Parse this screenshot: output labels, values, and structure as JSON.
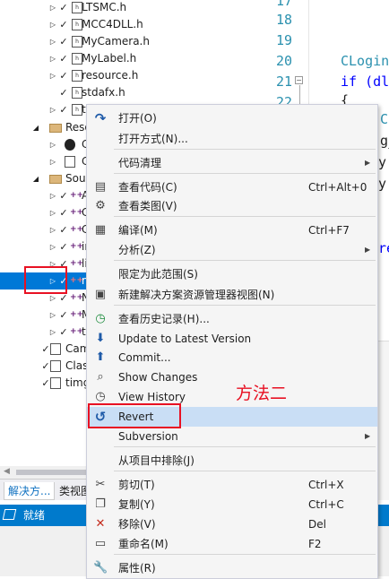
{
  "tree": {
    "rows": [
      {
        "label": "LTSMC.h",
        "icon": "header-file-icon"
      },
      {
        "label": "MCC4DLL.h",
        "icon": "header-file-icon"
      },
      {
        "label": "MyCamera.h",
        "icon": "header-file-icon"
      },
      {
        "label": "MyLabel.h",
        "icon": "header-file-icon"
      },
      {
        "label": "resource.h",
        "icon": "header-file-icon"
      },
      {
        "label": "stdafx.h",
        "icon": "header-file-icon"
      },
      {
        "label": "t",
        "icon": "header-file-icon"
      },
      {
        "label": "Reso",
        "icon": "folder-icon"
      },
      {
        "label": "C",
        "icon": "resource-icon"
      },
      {
        "label": "C",
        "icon": "resource-file-icon"
      },
      {
        "label": "Sour",
        "icon": "folder-icon"
      },
      {
        "label": "A",
        "icon": "cpp-file-icon"
      },
      {
        "label": "C",
        "icon": "cpp-file-icon"
      },
      {
        "label": "C",
        "icon": "cpp-file-icon"
      },
      {
        "label": "in",
        "icon": "cpp-file-icon"
      },
      {
        "label": "li",
        "icon": "cpp-file-icon"
      },
      {
        "label": "m",
        "icon": "cpp-file-icon"
      },
      {
        "label": "N",
        "icon": "cpp-file-icon"
      },
      {
        "label": "M",
        "icon": "cpp-file-icon"
      },
      {
        "label": "tl",
        "icon": "cpp-file-icon"
      },
      {
        "label": "Cam",
        "icon": "text-file-icon"
      },
      {
        "label": "Clas",
        "icon": "text-file-icon"
      },
      {
        "label": "timg",
        "icon": "image-file-icon"
      }
    ]
  },
  "editor": {
    "line_numbers": [
      "17",
      "18",
      "19",
      "20",
      "21",
      "22"
    ],
    "code_lines": [
      {
        "text": "CLogin",
        "kind": "ty"
      },
      {
        "text": "if (dl",
        "kind": "kw"
      },
      {
        "text": "{",
        "kind": "plain"
      }
    ],
    "fragments": [
      "Ca",
      "g_",
      "y.",
      "y.",
      "re"
    ]
  },
  "bottom_tabs": [
    "解决方...",
    "类视图"
  ],
  "status": {
    "text": "就绪"
  },
  "annotation": {
    "text": "方法二"
  },
  "menu": {
    "items": [
      {
        "label": "打开(O)",
        "shortcut": "",
        "submenu": false,
        "icon": "open-arrow-icon"
      },
      {
        "label": "打开方式(N)...",
        "shortcut": "",
        "submenu": false,
        "icon": ""
      },
      {
        "label": "代码清理",
        "shortcut": "",
        "submenu": true,
        "icon": ""
      },
      {
        "label": "查看代码(C)",
        "shortcut": "Ctrl+Alt+0",
        "submenu": false,
        "icon": "view-code-icon"
      },
      {
        "label": "查看类图(V)",
        "shortcut": "",
        "submenu": false,
        "icon": "class-diagram-icon"
      },
      {
        "label": "编译(M)",
        "shortcut": "Ctrl+F7",
        "submenu": false,
        "icon": "compile-icon"
      },
      {
        "label": "分析(Z)",
        "shortcut": "",
        "submenu": true,
        "icon": ""
      },
      {
        "label": "限定为此范围(S)",
        "shortcut": "",
        "submenu": false,
        "icon": ""
      },
      {
        "label": "新建解决方案资源管理器视图(N)",
        "shortcut": "",
        "submenu": false,
        "icon": "new-view-icon"
      },
      {
        "label": "查看历史记录(H)...",
        "shortcut": "",
        "submenu": false,
        "icon": "history-icon"
      },
      {
        "label": "Update to Latest Version",
        "shortcut": "",
        "submenu": false,
        "icon": "update-icon"
      },
      {
        "label": "Commit...",
        "shortcut": "",
        "submenu": false,
        "icon": "commit-icon"
      },
      {
        "label": "Show Changes",
        "shortcut": "",
        "submenu": false,
        "icon": "show-changes-icon"
      },
      {
        "label": "View History",
        "shortcut": "",
        "submenu": false,
        "icon": "view-history-icon"
      },
      {
        "label": "Revert",
        "shortcut": "",
        "submenu": false,
        "icon": "revert-icon"
      },
      {
        "label": "Subversion",
        "shortcut": "",
        "submenu": true,
        "icon": ""
      },
      {
        "label": "从项目中排除(J)",
        "shortcut": "",
        "submenu": false,
        "icon": ""
      },
      {
        "label": "剪切(T)",
        "shortcut": "Ctrl+X",
        "submenu": false,
        "icon": "cut-icon"
      },
      {
        "label": "复制(Y)",
        "shortcut": "Ctrl+C",
        "submenu": false,
        "icon": "copy-icon"
      },
      {
        "label": "移除(V)",
        "shortcut": "Del",
        "submenu": false,
        "icon": "remove-icon"
      },
      {
        "label": "重命名(M)",
        "shortcut": "F2",
        "submenu": false,
        "icon": "rename-icon"
      },
      {
        "label": "属性(R)",
        "shortcut": "",
        "submenu": false,
        "icon": "properties-icon"
      }
    ]
  },
  "colors": {
    "selection": "#0078d7",
    "menu_highlight": "#c9def5",
    "status_bar": "#007acc",
    "annotation_red": "#e81123"
  }
}
